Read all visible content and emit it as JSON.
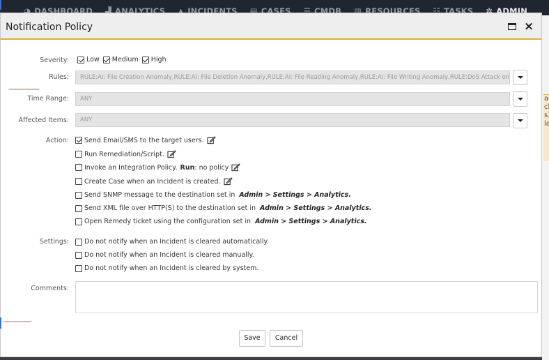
{
  "nav": {
    "items": [
      {
        "icon": "dashboard-icon",
        "label": "DASHBOARD"
      },
      {
        "icon": "analytics-icon",
        "label": "ANALYTICS"
      },
      {
        "icon": "incidents-icon",
        "label": "INCIDENTS"
      },
      {
        "icon": "cases-icon",
        "label": "CASES"
      },
      {
        "icon": "cmdb-icon",
        "label": "CMDB"
      },
      {
        "icon": "resources-icon",
        "label": "RESOURCES"
      },
      {
        "icon": "tasks-icon",
        "label": "TASKS"
      },
      {
        "icon": "admin-icon",
        "label": "ADMIN"
      }
    ]
  },
  "dialog": {
    "title": "Notification Policy"
  },
  "severity": {
    "label": "Severity:",
    "options": [
      {
        "label": "Low",
        "checked": true
      },
      {
        "label": "Medium",
        "checked": true
      },
      {
        "label": "High",
        "checked": true
      }
    ]
  },
  "rules": {
    "label": "Rules:",
    "value": "RULE:AI: File Creation Anomaly,RULE:AI: File Deletion Anomaly,RULE:AI: File Reading Anomaly,RULE:AI: File Writing Anomaly,RULE:DoS Attack on N"
  },
  "time_range": {
    "label": "Time Range:",
    "value": "ANY"
  },
  "affected_items": {
    "label": "Affected Items:",
    "value": "ANY"
  },
  "action": {
    "label": "Action:",
    "send_email": "Send Email/SMS to the target users.",
    "run_remediation": "Run Remediation/Script.",
    "invoke_integration": "Invoke an Integration Policy.",
    "run_label": "Run",
    "run_value": ": no policy",
    "create_case": "Create Case when an Incident is created.",
    "snmp": "Send SNMP message to the destination set in",
    "xml": "Send XML file over HTTP(S) to the destination set in",
    "remedy": "Open Remedy ticket using the configuration set in",
    "settings_path": "Admin > Settings > Analytics."
  },
  "settings": {
    "label": "Settings:",
    "auto": "Do not notify when an Incident is cleared automatically.",
    "manual": "Do not notify when an Incident is cleared manually.",
    "system": "Do not notify when an Incident is cleared by system."
  },
  "comments": {
    "label": "Comments:"
  },
  "buttons": {
    "save": "Save",
    "cancel": "Cancel"
  },
  "background_peek": [
    "ac",
    "cl",
    "s]",
    "la"
  ]
}
